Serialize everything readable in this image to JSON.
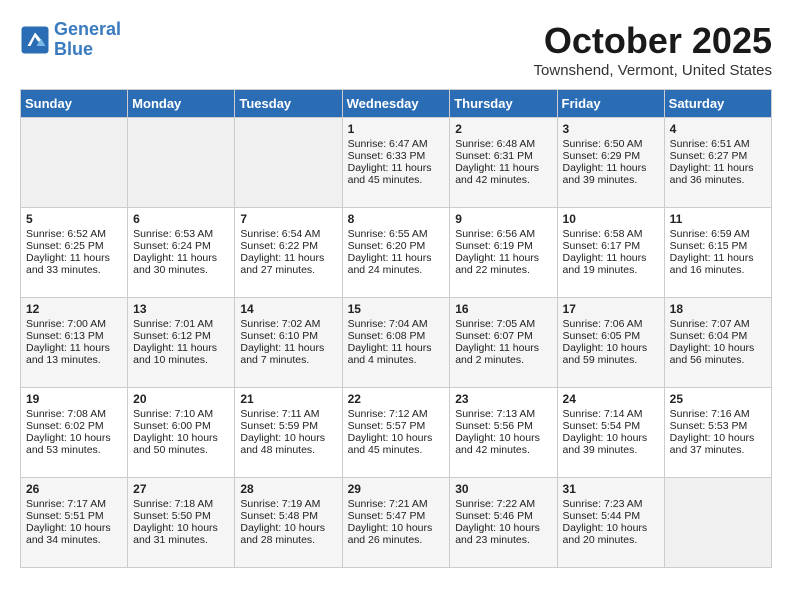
{
  "header": {
    "logo_line1": "General",
    "logo_line2": "Blue",
    "month": "October 2025",
    "location": "Townshend, Vermont, United States"
  },
  "days_of_week": [
    "Sunday",
    "Monday",
    "Tuesday",
    "Wednesday",
    "Thursday",
    "Friday",
    "Saturday"
  ],
  "weeks": [
    [
      {
        "day": "",
        "content": ""
      },
      {
        "day": "",
        "content": ""
      },
      {
        "day": "",
        "content": ""
      },
      {
        "day": "1",
        "content": "Sunrise: 6:47 AM\nSunset: 6:33 PM\nDaylight: 11 hours and 45 minutes."
      },
      {
        "day": "2",
        "content": "Sunrise: 6:48 AM\nSunset: 6:31 PM\nDaylight: 11 hours and 42 minutes."
      },
      {
        "day": "3",
        "content": "Sunrise: 6:50 AM\nSunset: 6:29 PM\nDaylight: 11 hours and 39 minutes."
      },
      {
        "day": "4",
        "content": "Sunrise: 6:51 AM\nSunset: 6:27 PM\nDaylight: 11 hours and 36 minutes."
      }
    ],
    [
      {
        "day": "5",
        "content": "Sunrise: 6:52 AM\nSunset: 6:25 PM\nDaylight: 11 hours and 33 minutes."
      },
      {
        "day": "6",
        "content": "Sunrise: 6:53 AM\nSunset: 6:24 PM\nDaylight: 11 hours and 30 minutes."
      },
      {
        "day": "7",
        "content": "Sunrise: 6:54 AM\nSunset: 6:22 PM\nDaylight: 11 hours and 27 minutes."
      },
      {
        "day": "8",
        "content": "Sunrise: 6:55 AM\nSunset: 6:20 PM\nDaylight: 11 hours and 24 minutes."
      },
      {
        "day": "9",
        "content": "Sunrise: 6:56 AM\nSunset: 6:19 PM\nDaylight: 11 hours and 22 minutes."
      },
      {
        "day": "10",
        "content": "Sunrise: 6:58 AM\nSunset: 6:17 PM\nDaylight: 11 hours and 19 minutes."
      },
      {
        "day": "11",
        "content": "Sunrise: 6:59 AM\nSunset: 6:15 PM\nDaylight: 11 hours and 16 minutes."
      }
    ],
    [
      {
        "day": "12",
        "content": "Sunrise: 7:00 AM\nSunset: 6:13 PM\nDaylight: 11 hours and 13 minutes."
      },
      {
        "day": "13",
        "content": "Sunrise: 7:01 AM\nSunset: 6:12 PM\nDaylight: 11 hours and 10 minutes."
      },
      {
        "day": "14",
        "content": "Sunrise: 7:02 AM\nSunset: 6:10 PM\nDaylight: 11 hours and 7 minutes."
      },
      {
        "day": "15",
        "content": "Sunrise: 7:04 AM\nSunset: 6:08 PM\nDaylight: 11 hours and 4 minutes."
      },
      {
        "day": "16",
        "content": "Sunrise: 7:05 AM\nSunset: 6:07 PM\nDaylight: 11 hours and 2 minutes."
      },
      {
        "day": "17",
        "content": "Sunrise: 7:06 AM\nSunset: 6:05 PM\nDaylight: 10 hours and 59 minutes."
      },
      {
        "day": "18",
        "content": "Sunrise: 7:07 AM\nSunset: 6:04 PM\nDaylight: 10 hours and 56 minutes."
      }
    ],
    [
      {
        "day": "19",
        "content": "Sunrise: 7:08 AM\nSunset: 6:02 PM\nDaylight: 10 hours and 53 minutes."
      },
      {
        "day": "20",
        "content": "Sunrise: 7:10 AM\nSunset: 6:00 PM\nDaylight: 10 hours and 50 minutes."
      },
      {
        "day": "21",
        "content": "Sunrise: 7:11 AM\nSunset: 5:59 PM\nDaylight: 10 hours and 48 minutes."
      },
      {
        "day": "22",
        "content": "Sunrise: 7:12 AM\nSunset: 5:57 PM\nDaylight: 10 hours and 45 minutes."
      },
      {
        "day": "23",
        "content": "Sunrise: 7:13 AM\nSunset: 5:56 PM\nDaylight: 10 hours and 42 minutes."
      },
      {
        "day": "24",
        "content": "Sunrise: 7:14 AM\nSunset: 5:54 PM\nDaylight: 10 hours and 39 minutes."
      },
      {
        "day": "25",
        "content": "Sunrise: 7:16 AM\nSunset: 5:53 PM\nDaylight: 10 hours and 37 minutes."
      }
    ],
    [
      {
        "day": "26",
        "content": "Sunrise: 7:17 AM\nSunset: 5:51 PM\nDaylight: 10 hours and 34 minutes."
      },
      {
        "day": "27",
        "content": "Sunrise: 7:18 AM\nSunset: 5:50 PM\nDaylight: 10 hours and 31 minutes."
      },
      {
        "day": "28",
        "content": "Sunrise: 7:19 AM\nSunset: 5:48 PM\nDaylight: 10 hours and 28 minutes."
      },
      {
        "day": "29",
        "content": "Sunrise: 7:21 AM\nSunset: 5:47 PM\nDaylight: 10 hours and 26 minutes."
      },
      {
        "day": "30",
        "content": "Sunrise: 7:22 AM\nSunset: 5:46 PM\nDaylight: 10 hours and 23 minutes."
      },
      {
        "day": "31",
        "content": "Sunrise: 7:23 AM\nSunset: 5:44 PM\nDaylight: 10 hours and 20 minutes."
      },
      {
        "day": "",
        "content": ""
      }
    ]
  ]
}
